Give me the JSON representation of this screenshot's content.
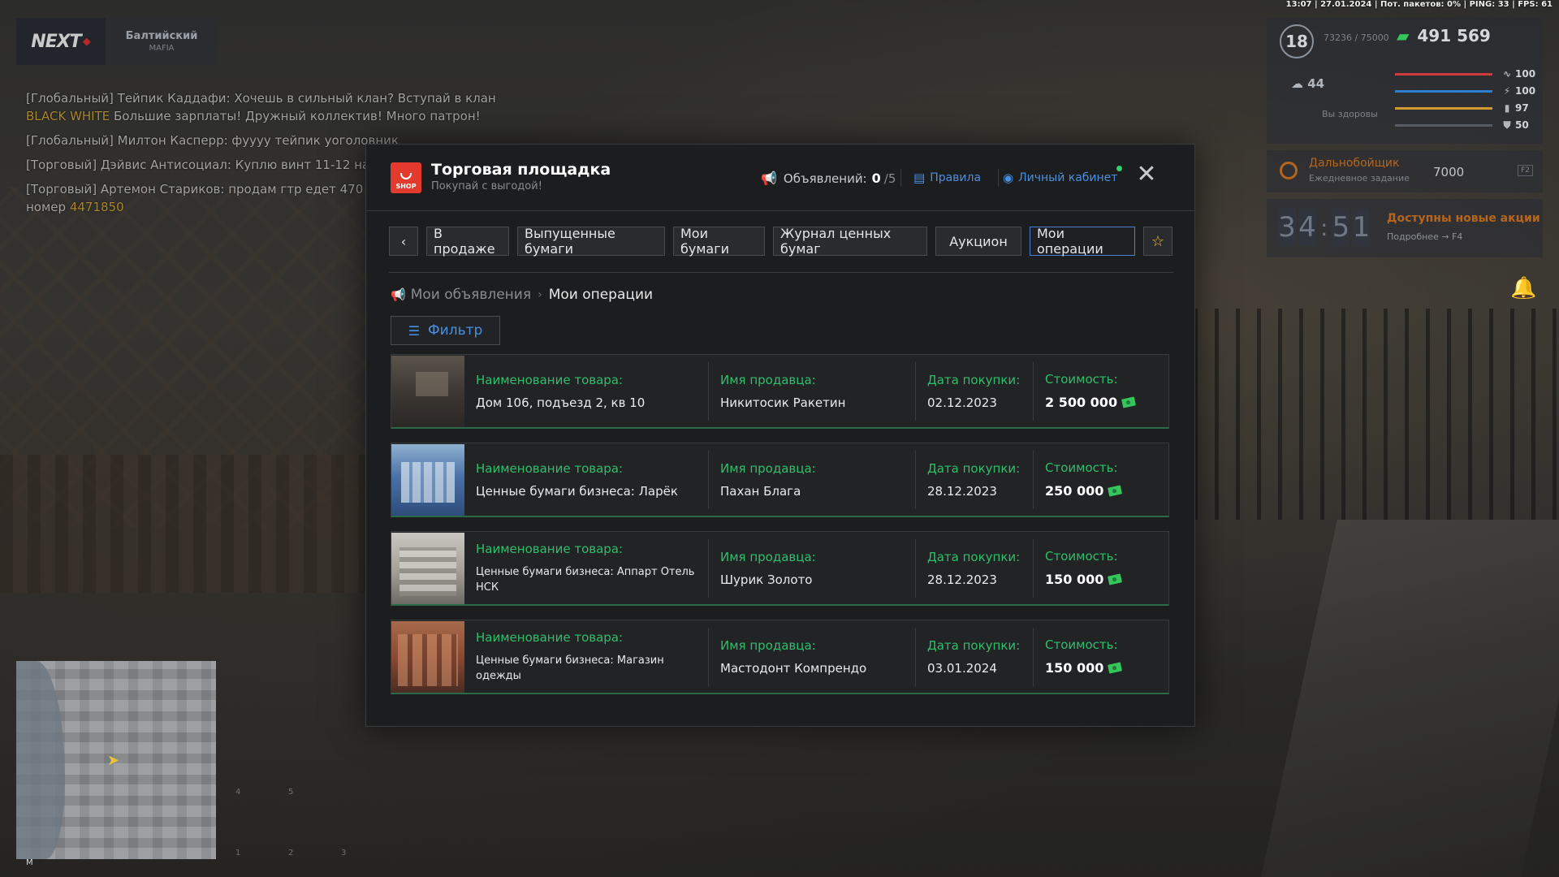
{
  "status_line": "13:07 | 27.01.2024 | Пот. пакетов: 0% | PING: 33 | FPS: 61",
  "logo": {
    "brand": "NEXT",
    "server_name": "Балтийский",
    "server_sub": "MAFIA"
  },
  "chat": [
    {
      "text": "[Глобальный] Тейпик Каддафи: Хочешь в сильный клан? Вступай в клан",
      "accent": "BLACK WHITE",
      "tail": " Большие зарплаты! Дружный коллектив! Много патрон!"
    },
    {
      "text": "[Глобальный] Милтон Касперр: фуууу тейпик уоголовник",
      "accent": "",
      "tail": ""
    },
    {
      "text": "[Торговый] Дэйвис Антисоциал: Куплю винт 11-12 на",
      "accent": "",
      "tail": ""
    },
    {
      "text": "[Торговый] Артемон Стариков: продам гтр едет 470 f лан под дрифт номер",
      "accent": "4471850",
      "tail": ""
    }
  ],
  "hud": {
    "level": "18",
    "exp": "73236 / 75000",
    "money": "491 569",
    "temperature": "44",
    "health_label": "Вы здоровы",
    "stats": [
      {
        "icon": "heartbeat-icon",
        "glyph": "∿",
        "value": "100",
        "color": "#d03b3b"
      },
      {
        "icon": "water-icon",
        "glyph": "⚡",
        "value": "100",
        "color": "#2f7fd0"
      },
      {
        "icon": "food-icon",
        "glyph": "▮",
        "value": "97",
        "color": "#d09a2f"
      },
      {
        "icon": "armor-icon",
        "glyph": "⛊",
        "value": "50",
        "color": "#555b63"
      }
    ],
    "armor_extra": "100"
  },
  "quest": {
    "title": "Дальнобойщик",
    "subtitle": "Ежедневное задание",
    "reward": "7000",
    "key": "F2"
  },
  "promo": {
    "timer": [
      "3",
      "4",
      "5",
      "1"
    ],
    "title": "Доступны новые акции",
    "subtitle": "Подробнее → F4"
  },
  "minimap": {
    "label": "M"
  },
  "modal": {
    "logo_text": "SHOP",
    "title": "Торговая площадка",
    "subtitle": "Покупай с выгодой!",
    "ads_label": "Объявлений:",
    "ads_count": "0",
    "ads_max": "/5",
    "rules": "Правила",
    "cabinet": "Личный кабинет",
    "tabs": [
      "В продаже",
      "Выпущенные бумаги",
      "Мои бумаги",
      "Журнал ценных бумаг",
      "Аукцион",
      "Мои операции"
    ],
    "active_tab": "Мои операции",
    "breadcrumb": {
      "parent": "Мои объявления",
      "current": "Мои операции"
    },
    "filter_label": "Фильтр",
    "columns": {
      "name": "Наименование товара:",
      "seller": "Имя продавца:",
      "date": "Дата покупки:",
      "price": "Стоимость:"
    },
    "operations": [
      {
        "name": "Дом 106, подъезд 2, кв 10",
        "seller": "Никитосик Ракетин",
        "date": "02.12.2023",
        "price": "2 500 000",
        "thumb": "house"
      },
      {
        "name": "Ценные бумаги бизнеса: Ларёк",
        "seller": "Пахан Блага",
        "date": "28.12.2023",
        "price": "250 000",
        "thumb": "kiosk"
      },
      {
        "name": "Ценные бумаги бизнеса: Аппарт Отель НСК",
        "seller": "Шурик Золото",
        "date": "28.12.2023",
        "price": "150 000",
        "thumb": "hotel"
      },
      {
        "name": "Ценные бумаги бизнеса: Магазин одежды",
        "seller": "Мастодонт Компрендо",
        "date": "03.01.2024",
        "price": "150 000",
        "thumb": "store"
      }
    ]
  }
}
